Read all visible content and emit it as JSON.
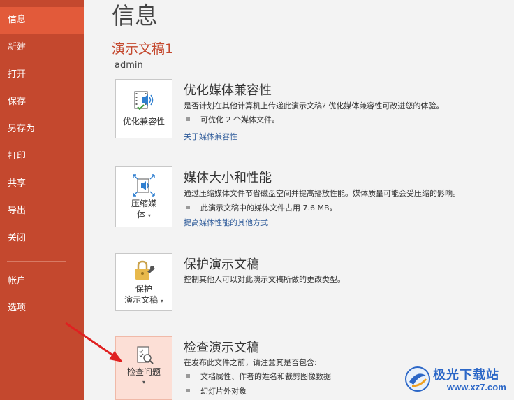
{
  "sidebar": {
    "items": [
      {
        "label": "信息",
        "active": true
      },
      {
        "label": "新建"
      },
      {
        "label": "打开"
      },
      {
        "label": "保存"
      },
      {
        "label": "另存为"
      },
      {
        "label": "打印"
      },
      {
        "label": "共享"
      },
      {
        "label": "导出"
      },
      {
        "label": "关闭"
      },
      {
        "label": "帐户"
      },
      {
        "label": "选项"
      }
    ]
  },
  "main": {
    "title": "信息",
    "doc_title": "演示文稿1",
    "author": "admin",
    "sections": [
      {
        "tile_label": "优化兼容性",
        "icon": "media-compatibility-icon",
        "title": "优化媒体兼容性",
        "desc": "是否计划在其他计算机上传递此演示文稿? 优化媒体兼容性可改进您的体验。",
        "bullet": "可优化 2 个媒体文件。",
        "link": "关于媒体兼容性"
      },
      {
        "tile_label_1": "压缩媒",
        "tile_label_2": "体",
        "caret": "▾",
        "icon": "compress-media-icon",
        "title": "媒体大小和性能",
        "desc": "通过压缩媒体文件节省磁盘空间并提高播放性能。媒体质量可能会受压缩的影响。",
        "bullet": "此演示文稿中的媒体文件占用 7.6 MB。",
        "link": "提高媒体性能的其他方式"
      },
      {
        "tile_label_1": "保护",
        "tile_label_2": "演示文稿",
        "caret": "▾",
        "icon": "lock-key-icon",
        "title": "保护演示文稿",
        "desc": "控制其他人可以对此演示文稿所做的更改类型。"
      },
      {
        "tile_label": "检查问题",
        "caret": "▾",
        "icon": "inspect-document-icon",
        "title": "检查演示文稿",
        "desc": "在发布此文件之前，请注意其是否包含:",
        "bullets": [
          "文档属性、作者的姓名和裁剪图像数据",
          "幻灯片外对象"
        ]
      }
    ]
  },
  "watermark": {
    "name": "极光下载站",
    "url": "www.xz7.com"
  },
  "colors": {
    "sidebar": "#c4482e",
    "sidebar_active": "#e25a3a",
    "accent_text": "#c4482e",
    "link": "#2e5b9a",
    "arrow": "#e02020"
  }
}
